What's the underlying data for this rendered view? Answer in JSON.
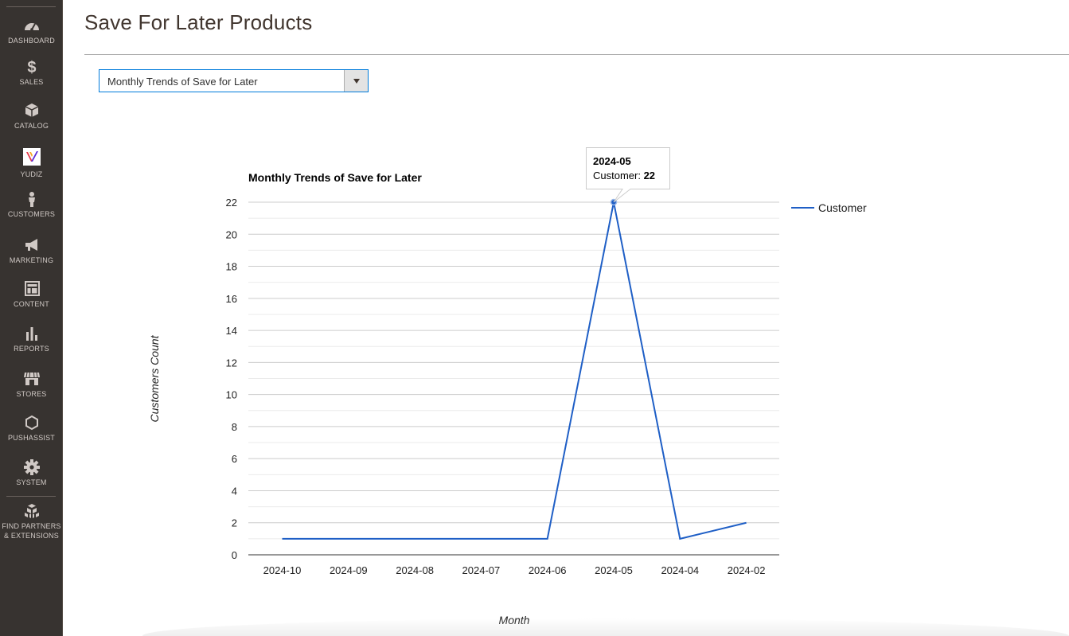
{
  "sidebar": {
    "items": [
      {
        "label": "DASHBOARD",
        "icon": "dashboard-icon"
      },
      {
        "label": "SALES",
        "icon": "dollar-icon"
      },
      {
        "label": "CATALOG",
        "icon": "box-icon"
      },
      {
        "label": "YUDIZ",
        "icon": "yudiz-logo-icon"
      },
      {
        "label": "CUSTOMERS",
        "icon": "person-icon"
      },
      {
        "label": "MARKETING",
        "icon": "megaphone-icon"
      },
      {
        "label": "CONTENT",
        "icon": "layout-icon"
      },
      {
        "label": "REPORTS",
        "icon": "bar-chart-icon"
      },
      {
        "label": "STORES",
        "icon": "storefront-icon"
      },
      {
        "label": "PUSHASSIST",
        "icon": "hexagon-icon"
      },
      {
        "label": "SYSTEM",
        "icon": "gear-icon"
      },
      {
        "label": "FIND PARTNERS & EXTENSIONS",
        "icon": "cubes-icon"
      }
    ]
  },
  "page": {
    "title": "Save For Later Products"
  },
  "report_select": {
    "value": "Monthly Trends of Save for Later"
  },
  "tooltip": {
    "title": "2024-05",
    "label": "Customer: ",
    "value": "22"
  },
  "colors": {
    "series": "#1f5fc6",
    "sidebar_bg": "#373330",
    "select_border": "#007bdb"
  },
  "chart_data": {
    "type": "line",
    "title": "Monthly Trends of Save for Later",
    "xlabel": "Month",
    "ylabel": "Customers Count",
    "categories": [
      "2024-10",
      "2024-09",
      "2024-08",
      "2024-07",
      "2024-06",
      "2024-05",
      "2024-04",
      "2024-02"
    ],
    "series": [
      {
        "name": "Customer",
        "values": [
          1,
          1,
          1,
          1,
          1,
          22,
          1,
          2
        ]
      }
    ],
    "ylim": [
      0,
      22
    ],
    "yticks": [
      0,
      2,
      4,
      6,
      8,
      10,
      12,
      14,
      16,
      18,
      20,
      22
    ],
    "grid": true,
    "legend": "right"
  }
}
